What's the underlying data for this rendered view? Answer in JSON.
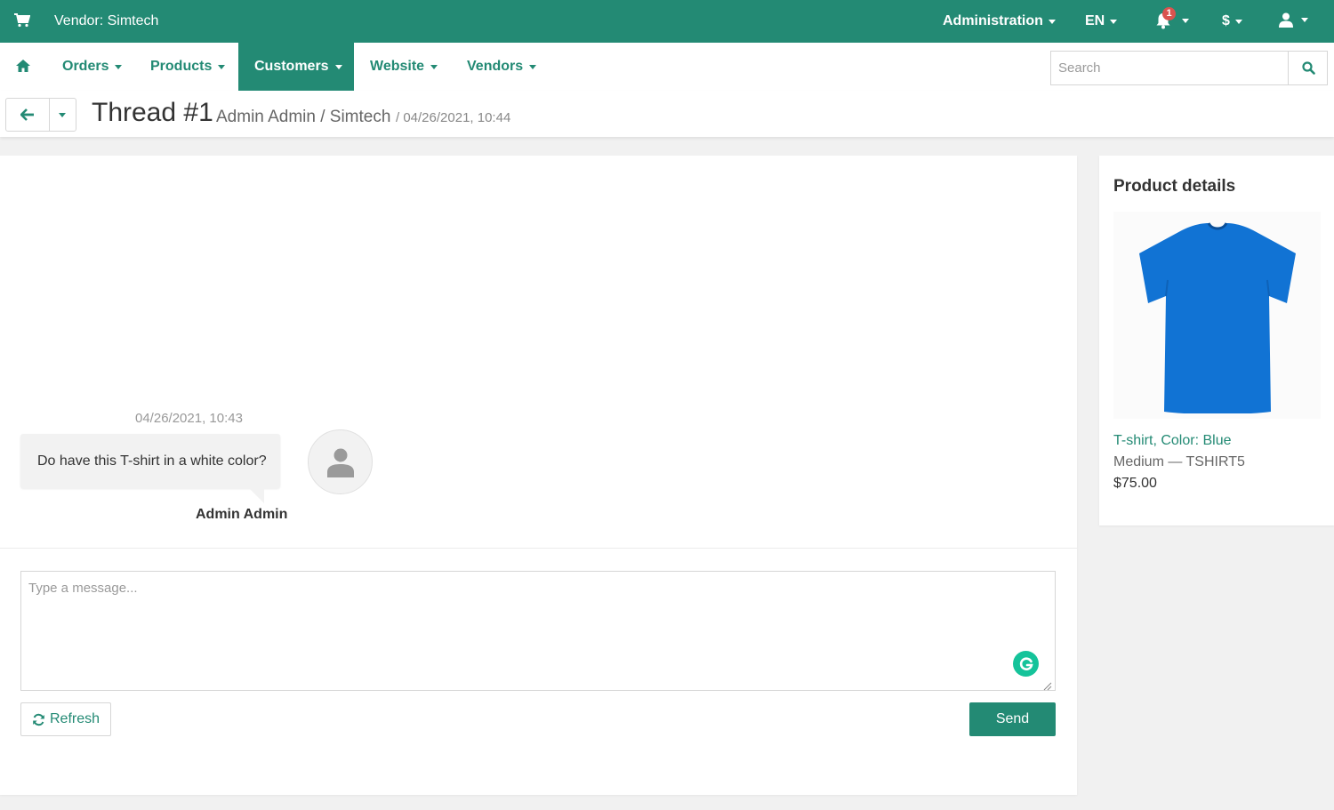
{
  "header": {
    "vendor_label": "Vendor: Simtech",
    "administration_label": "Administration",
    "language_label": "EN",
    "notifications_count": "1",
    "currency_label": "$"
  },
  "nav": {
    "items": [
      {
        "label": "Orders"
      },
      {
        "label": "Products"
      },
      {
        "label": "Customers"
      },
      {
        "label": "Website"
      },
      {
        "label": "Vendors"
      }
    ],
    "active": "Customers",
    "search_placeholder": "Search"
  },
  "thread": {
    "title": "Thread #1",
    "participants": "Admin Admin / Simtech",
    "date": "/ 04/26/2021, 10:44"
  },
  "messages": [
    {
      "date": "04/26/2021, 10:43",
      "text": "Do have this T-shirt in a white color?",
      "author": "Admin Admin"
    }
  ],
  "composer": {
    "placeholder": "Type a message...",
    "refresh_label": "Refresh",
    "send_label": "Send"
  },
  "product": {
    "section_title": "Product details",
    "name": "T-shirt, Color: Blue",
    "variant": "Medium — TSHIRT5",
    "price": "$75.00",
    "image_color": "#1173d4"
  },
  "colors": {
    "primary": "#238a74",
    "badge": "#d9534f",
    "grammarly": "#15c39a"
  }
}
